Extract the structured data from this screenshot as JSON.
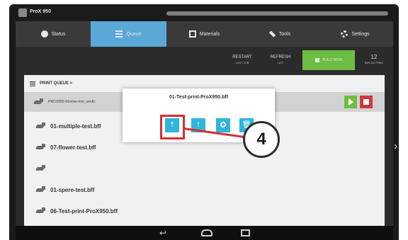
{
  "app": {
    "title": "ProX 950",
    "progress": 0
  },
  "nav": {
    "tabs": [
      {
        "label": "Status",
        "icon": "status-icon",
        "active": false
      },
      {
        "label": "Queue",
        "icon": "queue-icon",
        "active": true
      },
      {
        "label": "Materials",
        "icon": "materials-icon",
        "active": false
      },
      {
        "label": "Tools",
        "icon": "tools-icon",
        "active": false
      },
      {
        "label": "Settings",
        "icon": "settings-icon",
        "active": false
      }
    ]
  },
  "actions": {
    "restart": {
      "label": "RESTART",
      "sub": "LAST JOB"
    },
    "refresh": {
      "label": "REFRESH",
      "sub": "LIST"
    },
    "green": {
      "label": "BUILD NOW",
      "icon": "build-icon"
    },
    "free": {
      "count": "12",
      "label": "BUILDS FREE"
    }
  },
  "queue": {
    "header": "PRINT QUEUE >",
    "current_job": "PROX950-Stneise-mm_venfic",
    "files": [
      "01-multiple-test.bff",
      "07-flower-test.bff",
      "",
      "01-spere-test.bff",
      "06-Test-print-ProX950.bff"
    ]
  },
  "dialog": {
    "title": "01-Test-print-ProX950.bff",
    "buttons": [
      {
        "icon": "move-to-top-icon",
        "glyph": "⤒"
      },
      {
        "icon": "info-icon",
        "glyph": "!"
      },
      {
        "icon": "clock-icon",
        "glyph": ""
      },
      {
        "icon": "delete-icon",
        "glyph": "🗑"
      }
    ]
  },
  "callout": {
    "label": "4"
  },
  "colors": {
    "accent": "#5aa8d8",
    "highlight": "#d63030",
    "green": "#6dbd45",
    "stop": "#d23a3a",
    "dialog_button": "#2fb5de"
  }
}
